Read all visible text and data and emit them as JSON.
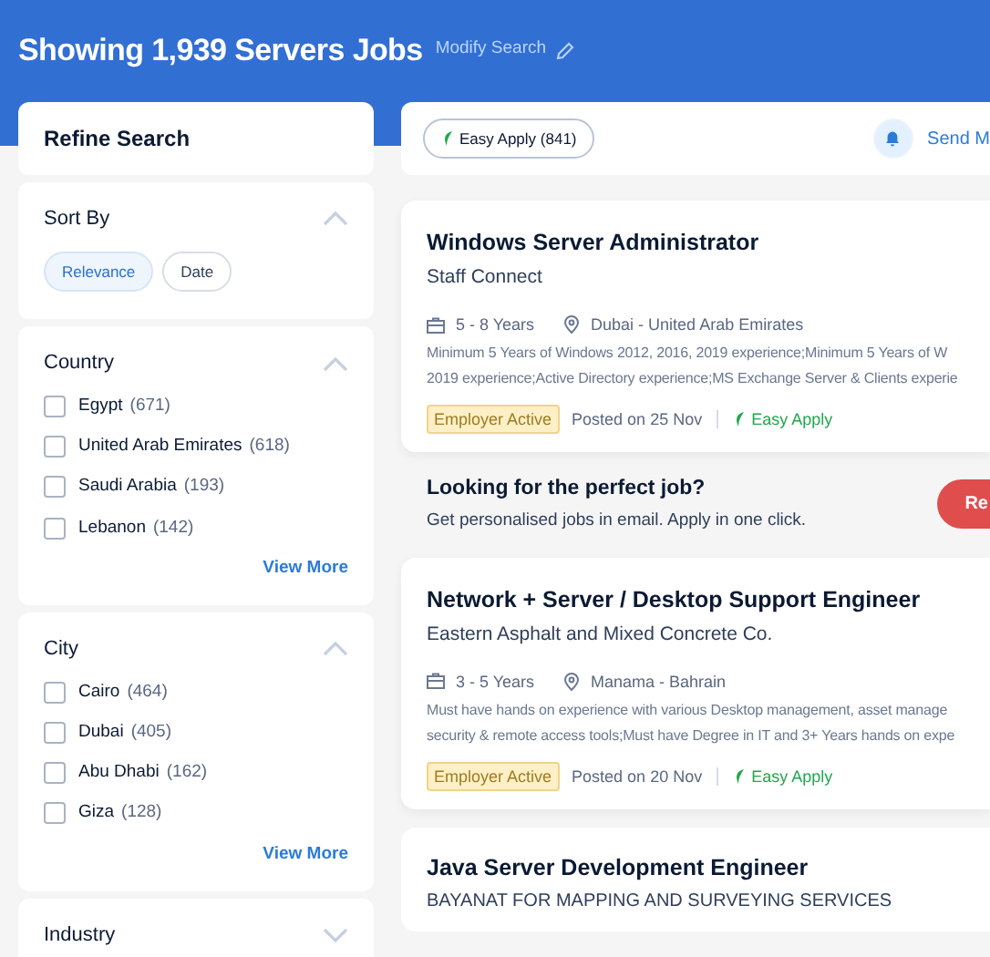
{
  "header": {
    "title": "Showing 1,939 Servers Jobs",
    "modify_link": "Modify Search"
  },
  "refine_title": "Refine Search",
  "sort": {
    "title": "Sort By",
    "expanded": true,
    "options": [
      {
        "label": "Relevance",
        "selected": true
      },
      {
        "label": "Date",
        "selected": false
      }
    ]
  },
  "filters": [
    {
      "title": "Country",
      "expanded": true,
      "items": [
        {
          "label": "Egypt",
          "count": "(671)",
          "checked": false
        },
        {
          "label": "United Arab Emirates",
          "count": "(618)",
          "checked": false
        },
        {
          "label": "Saudi Arabia",
          "count": "(193)",
          "checked": false
        },
        {
          "label": "Lebanon",
          "count": "(142)",
          "checked": false
        }
      ],
      "more": "View More"
    },
    {
      "title": "City",
      "expanded": true,
      "items": [
        {
          "label": "Cairo",
          "count": "(464)",
          "checked": false
        },
        {
          "label": "Dubai",
          "count": "(405)",
          "checked": false
        },
        {
          "label": "Abu Dhabi",
          "count": "(162)",
          "checked": false
        },
        {
          "label": "Giza",
          "count": "(128)",
          "checked": false
        }
      ],
      "more": "View More"
    },
    {
      "title": "Industry",
      "expanded": false
    }
  ],
  "toolbar": {
    "easy_apply_chip": "Easy Apply (841)",
    "alert_link": "Send M"
  },
  "jobs": [
    {
      "title": "Windows Server Administrator",
      "company": "Staff Connect",
      "experience": "5 - 8 Years",
      "location": "Dubai - United Arab Emirates",
      "description_lines": [
        "Minimum 5 Years of Windows 2012, 2016, 2019 experience;Minimum 5 Years of W",
        "2019 experience;Active Directory experience;MS Exchange Server & Clients experie"
      ],
      "badge": "Employer Active",
      "posted": "Posted on 25 Nov",
      "easy_apply": "Easy Apply"
    },
    {
      "kind": "banner",
      "title": "Looking for the perfect job?",
      "text": "Get personalised jobs in email. Apply in one click.",
      "button": "Re"
    },
    {
      "title": "Network + Server / Desktop Support Engineer",
      "company": "Eastern Asphalt and Mixed Concrete Co.",
      "experience": "3 - 5 Years",
      "location": "Manama - Bahrain",
      "description_lines": [
        "Must have hands on experience with various Desktop management, asset manage",
        "security & remote access tools;Must have Degree in IT and 3+ Years hands on expe"
      ],
      "badge": "Employer Active",
      "posted": "Posted on 20 Nov",
      "easy_apply": "Easy Apply"
    },
    {
      "title": "Java Server Development Engineer",
      "company": "BAYANAT FOR MAPPING AND SURVEYING SERVICES"
    }
  ]
}
